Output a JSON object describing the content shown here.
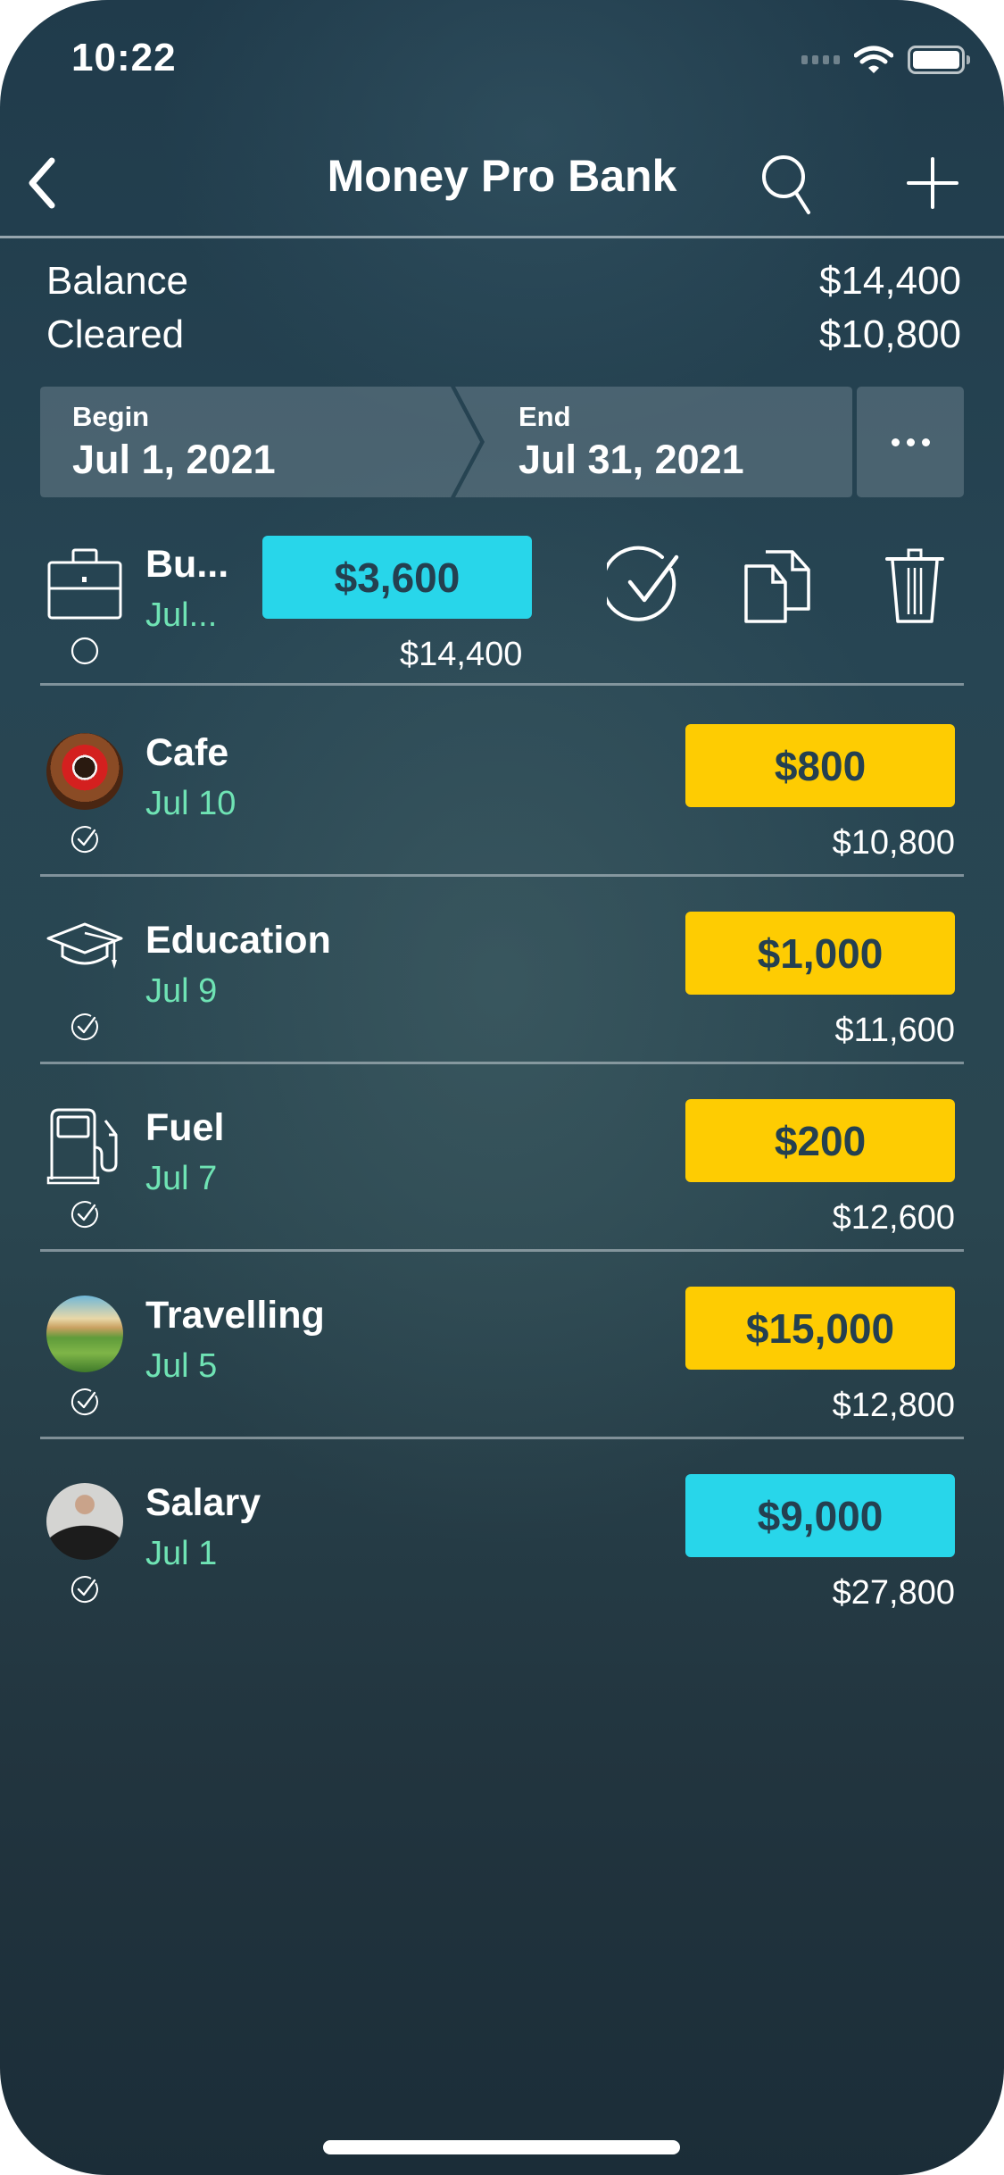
{
  "status_bar": {
    "time": "10:22",
    "icons": [
      "signal-icon",
      "wifi-icon",
      "battery-icon"
    ]
  },
  "nav": {
    "title": "Money Pro Bank",
    "back_icon": "chevron-left-icon",
    "search_icon": "search-icon",
    "add_icon": "plus-icon"
  },
  "summary": {
    "balance_label": "Balance",
    "balance_value": "$14,400",
    "cleared_label": "Cleared",
    "cleared_value": "$10,800"
  },
  "date_range": {
    "begin_label": "Begin",
    "begin_value": "Jul 1, 2021",
    "end_label": "End",
    "end_value": "Jul 31, 2021",
    "more_icon": "ellipsis-icon"
  },
  "colors": {
    "income": "#28d6ea",
    "expense": "#fecc02",
    "date_text": "#6fe3b4",
    "amount_text": "#244050"
  },
  "selected_transaction": {
    "name": "Bu...",
    "date": "Jul...",
    "amount": "$3,600",
    "running_balance": "$14,400",
    "type": "income",
    "icon": "briefcase-icon",
    "cleared": false,
    "actions": [
      {
        "name": "clear",
        "icon": "check-circle-icon"
      },
      {
        "name": "duplicate",
        "icon": "copy-icon"
      },
      {
        "name": "delete",
        "icon": "trash-icon"
      }
    ]
  },
  "transactions": [
    {
      "name": "Cafe",
      "date": "Jul 10",
      "amount": "$800",
      "running_balance": "$10,800",
      "type": "expense",
      "icon": "coffee-cup-icon",
      "cleared": true
    },
    {
      "name": "Education",
      "date": "Jul 9",
      "amount": "$1,000",
      "running_balance": "$11,600",
      "type": "expense",
      "icon": "graduation-cap-icon",
      "cleared": true
    },
    {
      "name": "Fuel",
      "date": "Jul 7",
      "amount": "$200",
      "running_balance": "$12,600",
      "type": "expense",
      "icon": "fuel-pump-icon",
      "cleared": true
    },
    {
      "name": "Travelling",
      "date": "Jul 5",
      "amount": "$15,000",
      "running_balance": "$12,800",
      "type": "expense",
      "icon": "travel-photo-icon",
      "cleared": true
    },
    {
      "name": "Salary",
      "date": "Jul 1",
      "amount": "$9,000",
      "running_balance": "$27,800",
      "type": "income",
      "icon": "person-photo-icon",
      "cleared": true
    }
  ]
}
